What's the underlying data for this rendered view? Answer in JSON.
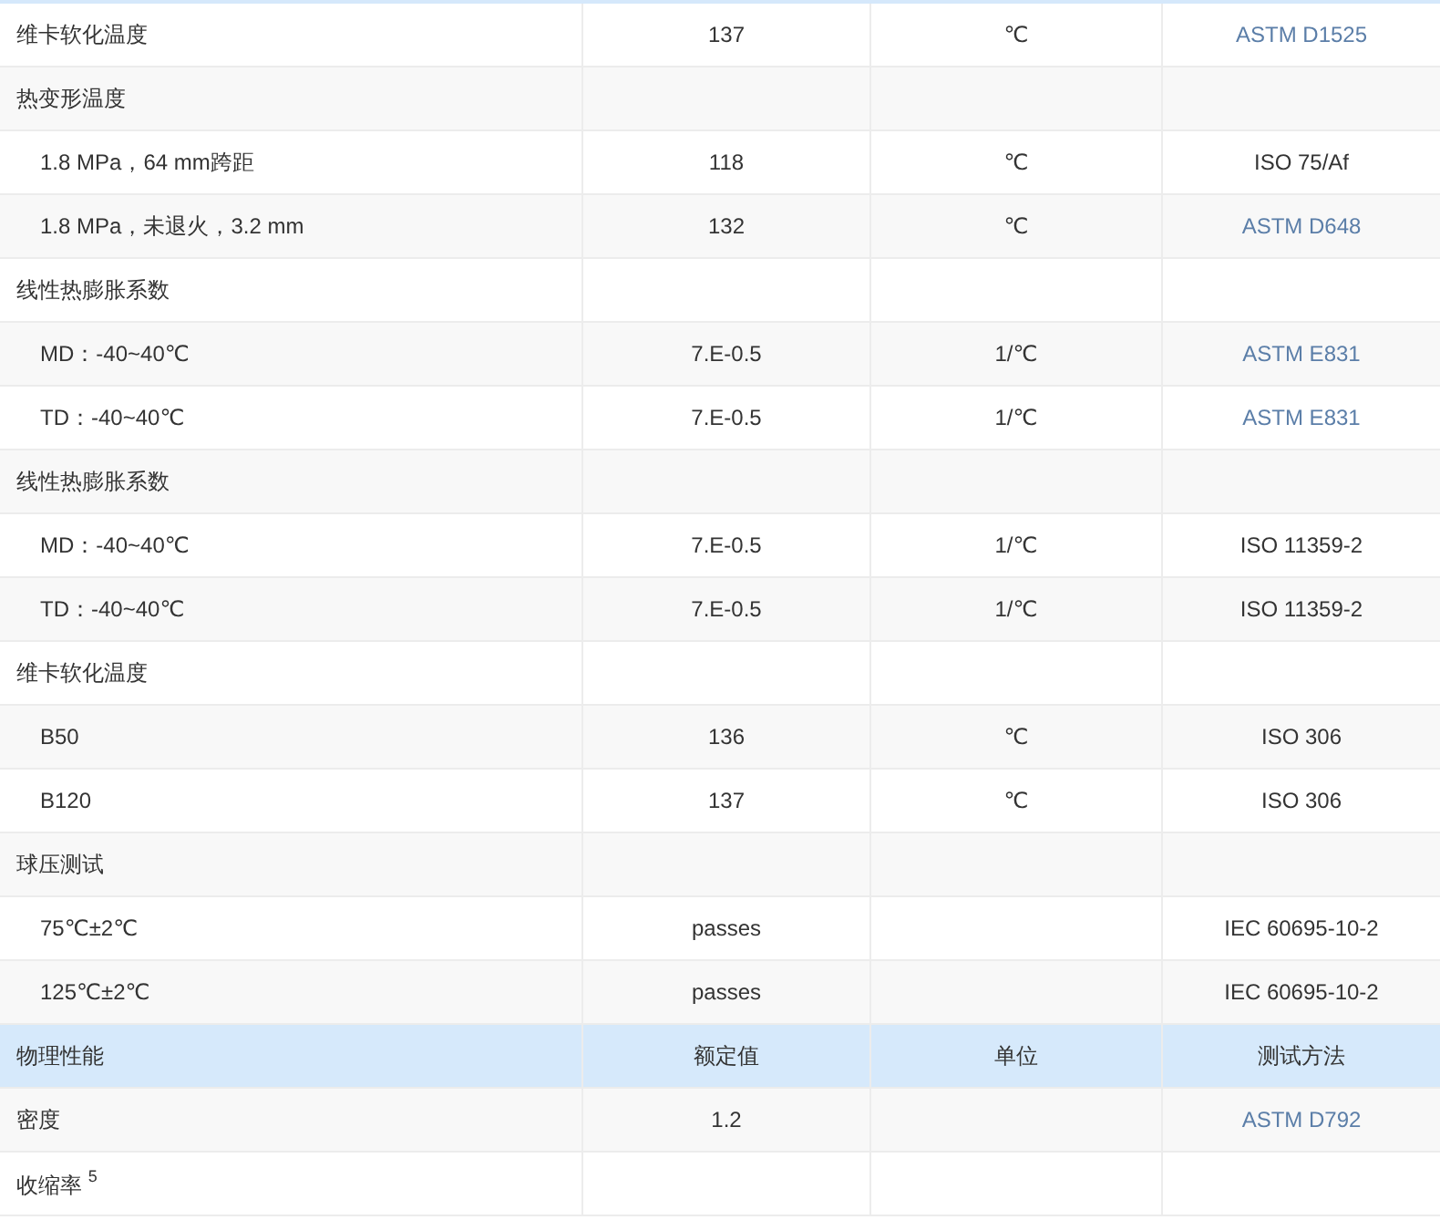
{
  "table": {
    "rows": [
      {
        "kind": "item",
        "label": "维卡软化温度",
        "value": "137",
        "unit": "℃",
        "method": "ASTM D1525",
        "method_link": true
      },
      {
        "kind": "group",
        "label": "热变形温度"
      },
      {
        "kind": "sub",
        "label": "1.8 MPa，64 mm跨距",
        "value": "118",
        "unit": "℃",
        "method": "ISO 75/Af",
        "method_link": false
      },
      {
        "kind": "sub",
        "label": "1.8 MPa，未退火，3.2 mm",
        "value": "132",
        "unit": "℃",
        "method": "ASTM D648",
        "method_link": true
      },
      {
        "kind": "group",
        "label": "线性热膨胀系数"
      },
      {
        "kind": "sub",
        "label": "MD：-40~40℃",
        "value": "7.E-0.5",
        "unit": "1/℃",
        "method": "ASTM E831",
        "method_link": true
      },
      {
        "kind": "sub",
        "label": "TD：-40~40℃",
        "value": "7.E-0.5",
        "unit": "1/℃",
        "method": "ASTM E831",
        "method_link": true
      },
      {
        "kind": "group",
        "label": "线性热膨胀系数"
      },
      {
        "kind": "sub",
        "label": "MD：-40~40℃",
        "value": "7.E-0.5",
        "unit": "1/℃",
        "method": "ISO 11359-2",
        "method_link": false
      },
      {
        "kind": "sub",
        "label": "TD：-40~40℃",
        "value": "7.E-0.5",
        "unit": "1/℃",
        "method": "ISO 11359-2",
        "method_link": false
      },
      {
        "kind": "group",
        "label": "维卡软化温度"
      },
      {
        "kind": "sub",
        "label": "B50",
        "value": "136",
        "unit": "℃",
        "method": "ISO 306",
        "method_link": false
      },
      {
        "kind": "sub",
        "label": "B120",
        "value": "137",
        "unit": "℃",
        "method": "ISO 306",
        "method_link": false
      },
      {
        "kind": "group",
        "label": "球压测试"
      },
      {
        "kind": "sub",
        "label": "75℃±2℃",
        "value": "passes",
        "method": "IEC 60695-10-2",
        "method_link": false
      },
      {
        "kind": "sub",
        "label": "125℃±2℃",
        "value": "passes",
        "method": "IEC 60695-10-2",
        "method_link": false
      },
      {
        "kind": "header",
        "label": "物理性能",
        "value": "额定值",
        "unit": "单位",
        "method": "测试方法"
      },
      {
        "kind": "item",
        "label": "密度",
        "value": "1.2",
        "method": "ASTM D792",
        "method_link": true
      },
      {
        "kind": "group",
        "label": "收缩率 $^{5}$"
      }
    ]
  }
}
